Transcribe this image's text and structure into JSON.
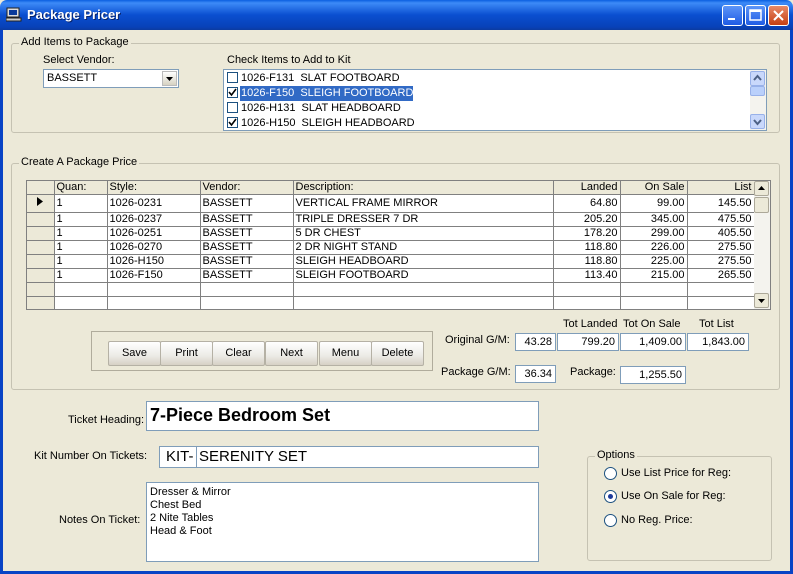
{
  "window": {
    "title": "Package Pricer",
    "icon": "computer-icon"
  },
  "add_items": {
    "group_label": "Add Items to Package",
    "vendor_label": "Select Vendor:",
    "vendor_value": "BASSETT",
    "check_label": "Check Items to Add to Kit",
    "items": [
      {
        "text": "1026-F131  SLAT FOOTBOARD",
        "checked": false,
        "selected": false
      },
      {
        "text": "1026-F150  SLEIGH FOOTBOARD",
        "checked": true,
        "selected": true
      },
      {
        "text": "1026-H131  SLAT HEADBOARD",
        "checked": false,
        "selected": false
      },
      {
        "text": "1026-H150  SLEIGH HEADBOARD",
        "checked": true,
        "selected": false
      }
    ]
  },
  "package": {
    "group_label": "Create A Package Price",
    "columns": [
      "Quan:",
      "Style:",
      "Vendor:",
      "Description:",
      "Landed",
      "On Sale",
      "List"
    ],
    "rows": [
      [
        "1",
        "1026-0231",
        "BASSETT",
        "VERTICAL FRAME MIRROR",
        "64.80",
        "99.00",
        "145.50"
      ],
      [
        "1",
        "1026-0237",
        "BASSETT",
        "TRIPLE DRESSER 7 DR",
        "205.20",
        "345.00",
        "475.50"
      ],
      [
        "1",
        "1026-0251",
        "BASSETT",
        "5 DR CHEST",
        "178.20",
        "299.00",
        "405.50"
      ],
      [
        "1",
        "1026-0270",
        "BASSETT",
        "2 DR NIGHT STAND",
        "118.80",
        "226.00",
        "275.50"
      ],
      [
        "1",
        "1026-H150",
        "BASSETT",
        "SLEIGH HEADBOARD",
        "118.80",
        "225.00",
        "275.50"
      ],
      [
        "1",
        "1026-F150",
        "BASSETT",
        "SLEIGH FOOTBOARD",
        "113.40",
        "215.00",
        "265.50"
      ]
    ],
    "buttons": {
      "save": "Save",
      "print": "Print",
      "clear": "Clear",
      "next": "Next",
      "menu": "Menu",
      "delete": "Delete"
    },
    "totals": {
      "tot_landed_label": "Tot Landed",
      "tot_on_sale_label": "Tot On Sale",
      "tot_list_label": "Tot List",
      "original_gm_label": "Original G/M:",
      "original_gm": "43.28",
      "tot_landed": "799.20",
      "tot_on_sale": "1,409.00",
      "tot_list": "1,843.00",
      "package_gm_label": "Package G/M:",
      "package_gm": "36.34",
      "package_label": "Package:",
      "package_price": "1,255.50"
    }
  },
  "ticket": {
    "heading_label": "Ticket Heading:",
    "heading_value": "7-Piece Bedroom Set",
    "kit_label": "Kit Number On Tickets:",
    "kit_prefix": "KIT-",
    "kit_value": "SERENITY SET",
    "notes_label": "Notes On Ticket:",
    "notes_lines": [
      "Dresser & Mirror",
      "Chest Bed",
      "2 Nite Tables",
      "Head & Foot"
    ]
  },
  "options": {
    "group_label": "Options",
    "items": [
      {
        "label": "Use List Price for Reg:",
        "selected": false
      },
      {
        "label": "Use On Sale for Reg:",
        "selected": true
      },
      {
        "label": "No Reg. Price:",
        "selected": false
      }
    ]
  },
  "colors": {
    "titlebar": "#0A4FD0",
    "window_bg": "#ECE9D8",
    "selection": "#316AC5"
  }
}
